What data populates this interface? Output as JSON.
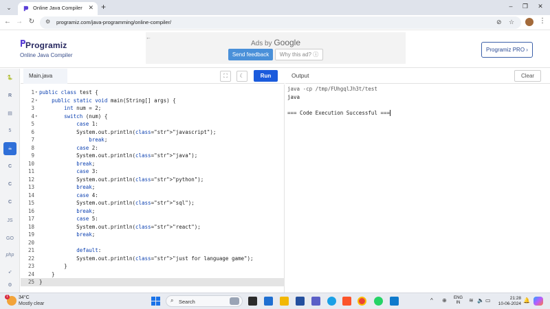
{
  "browser": {
    "tab_title": "Online Java Compiler",
    "tab_close": "✕",
    "new_tab": "+",
    "url": "programiz.com/java-programming/online-compiler/",
    "window_controls": [
      "–",
      "❐",
      "✕"
    ],
    "icons": [
      "tab-search-icon",
      "back-icon",
      "forward-icon",
      "reload-icon",
      "site-info-icon",
      "eye-off-icon",
      "star-icon",
      "kebab-menu-icon"
    ]
  },
  "site": {
    "logo": "Programiz",
    "subtitle": "Online Java Compiler",
    "pro_button": "Programiz PRO ›",
    "ad": {
      "ads_by": "Ads by",
      "google": "Google",
      "send_feedback": "Send feedback",
      "why_this_ad": "Why this ad? ⓘ",
      "back": "←"
    }
  },
  "sidebar": {
    "items": [
      {
        "name": "python",
        "label": "🐍"
      },
      {
        "name": "r",
        "label": "R"
      },
      {
        "name": "sql",
        "label": "▤"
      },
      {
        "name": "html",
        "label": "5"
      },
      {
        "name": "java",
        "label": "☕",
        "active": true
      },
      {
        "name": "c",
        "label": "C"
      },
      {
        "name": "cpp",
        "label": "C"
      },
      {
        "name": "csharp",
        "label": "C"
      },
      {
        "name": "js",
        "label": "JS"
      },
      {
        "name": "go",
        "label": "GO"
      },
      {
        "name": "php",
        "label": "php"
      },
      {
        "name": "swift",
        "label": "➶"
      },
      {
        "name": "rust",
        "label": "⚙"
      }
    ]
  },
  "editor": {
    "file_name": "Main.java",
    "fullscreen_icon": "⛶",
    "theme_icon": "☾",
    "run_label": "Run",
    "lines": [
      {
        "n": "1",
        "fold": "▾",
        "code": "public class test {"
      },
      {
        "n": "2",
        "fold": "▾",
        "code": "    public static void main(String[] args) {"
      },
      {
        "n": "3",
        "fold": "",
        "code": "        int num = 2;"
      },
      {
        "n": "4",
        "fold": "▾",
        "code": "        switch (num) {"
      },
      {
        "n": "5",
        "fold": "",
        "code": "            case 1:"
      },
      {
        "n": "6",
        "fold": "",
        "code": "            System.out.println(\"javascript\");"
      },
      {
        "n": "7",
        "fold": "",
        "code": "                break;"
      },
      {
        "n": "8",
        "fold": "",
        "code": "            case 2:"
      },
      {
        "n": "9",
        "fold": "",
        "code": "            System.out.println(\"java\");"
      },
      {
        "n": "10",
        "fold": "",
        "code": "            break;"
      },
      {
        "n": "11",
        "fold": "",
        "code": "            case 3:"
      },
      {
        "n": "12",
        "fold": "",
        "code": "            System.out.println(\"python\");"
      },
      {
        "n": "13",
        "fold": "",
        "code": "            break;"
      },
      {
        "n": "14",
        "fold": "",
        "code": "            case 4:"
      },
      {
        "n": "15",
        "fold": "",
        "code": "            System.out.println(\"sql\");"
      },
      {
        "n": "16",
        "fold": "",
        "code": "            break;"
      },
      {
        "n": "17",
        "fold": "",
        "code": "            case 5:"
      },
      {
        "n": "18",
        "fold": "",
        "code": "            System.out.println(\"react\");"
      },
      {
        "n": "19",
        "fold": "",
        "code": "            break;"
      },
      {
        "n": "20",
        "fold": "",
        "code": ""
      },
      {
        "n": "21",
        "fold": "",
        "code": "            default:"
      },
      {
        "n": "22",
        "fold": "",
        "code": "            System.out.println(\"just for language game\");"
      },
      {
        "n": "23",
        "fold": "",
        "code": "        }"
      },
      {
        "n": "24",
        "fold": "",
        "code": "    }"
      },
      {
        "n": "25",
        "fold": "",
        "code": "}",
        "current": true
      }
    ]
  },
  "output": {
    "title": "Output",
    "clear_label": "Clear",
    "lines": [
      {
        "text": "java -cp /tmp/FUhgqlJh3t/test",
        "kind": "cmd"
      },
      {
        "text": "java",
        "kind": "out"
      },
      {
        "text": "",
        "kind": "out"
      },
      {
        "text": "=== Code Execution Successful ===",
        "kind": "out",
        "cursor": true
      }
    ]
  },
  "taskbar": {
    "temperature": "34°C",
    "condition": "Mostly clear",
    "weather_badge": "1",
    "search_placeholder": "Search",
    "language_line1": "ENG",
    "language_line2": "IN",
    "time": "21:28",
    "date": "10-06-2024",
    "tray_icons": [
      "^",
      "⊕",
      "≋",
      "🔈",
      "▭"
    ]
  },
  "colors": {
    "accent": "#1b5bdc",
    "sidebar_active": "#2f6fd8",
    "brand_dark": "#25265e"
  }
}
